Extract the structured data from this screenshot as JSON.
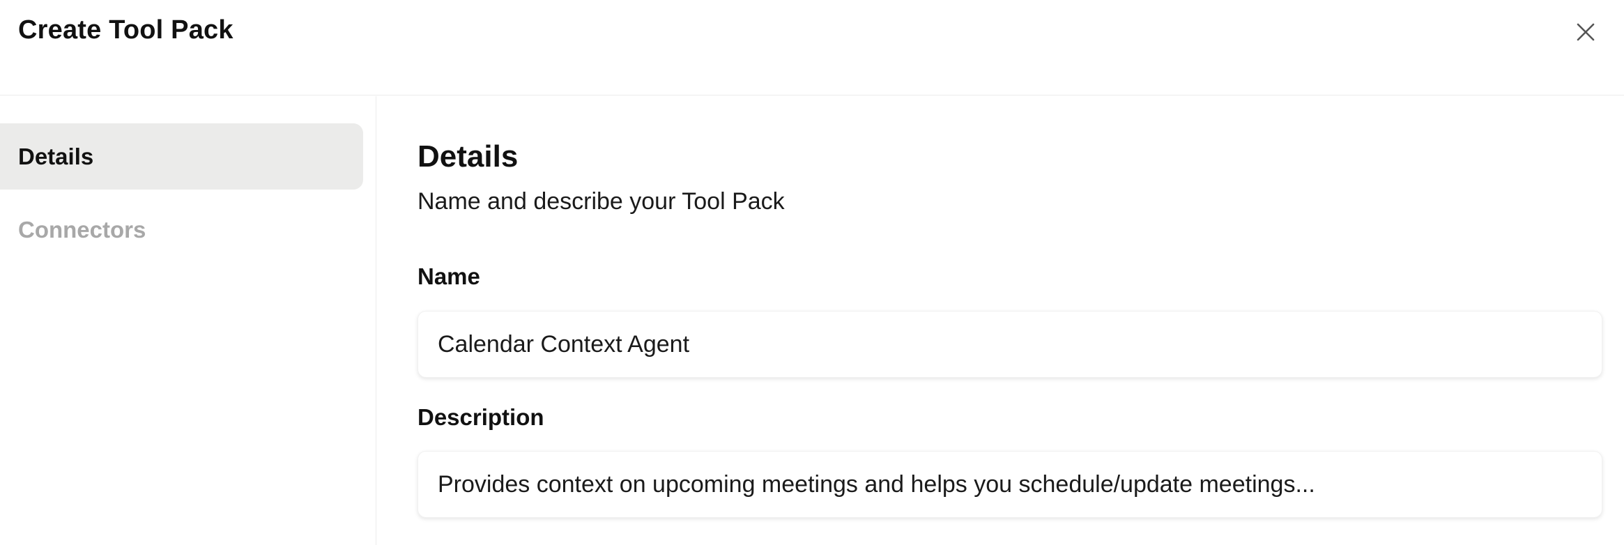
{
  "dialog": {
    "title": "Create Tool Pack",
    "close_icon": "close-icon"
  },
  "sidebar": {
    "items": [
      {
        "label": "Details",
        "active": true
      },
      {
        "label": "Connectors",
        "active": false
      }
    ]
  },
  "main": {
    "section_title": "Details",
    "section_subtitle": "Name and describe your Tool Pack",
    "name_label": "Name",
    "name_value": "Calendar Context Agent",
    "description_label": "Description",
    "description_value": "Provides context on upcoming meetings and helps you schedule/update meetings..."
  },
  "colors": {
    "active_nav_bg": "#ebebea",
    "inactive_nav_text": "#a8a8a8",
    "divider": "#ececec"
  }
}
